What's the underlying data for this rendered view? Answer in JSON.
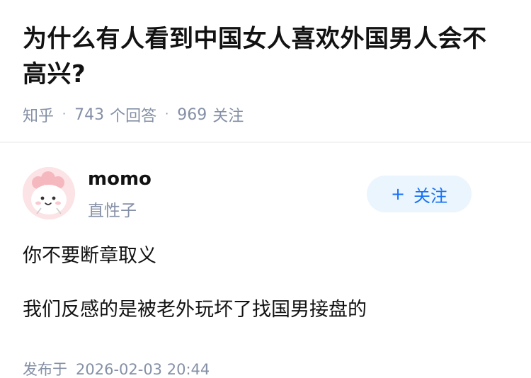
{
  "question": {
    "title": "为什么有人看到中国女人喜欢外国男人会不高兴?",
    "source": "知乎",
    "answer_count": "743",
    "answer_unit": "个回答",
    "follower_count": "969",
    "follower_unit": "关注"
  },
  "answer": {
    "author": {
      "name": "momo",
      "bio": "直性子",
      "avatar_icon": "cartoon-avatar-icon"
    },
    "follow_button": {
      "plus": "+",
      "label": "关注"
    },
    "paragraphs": [
      "你不要断章取义",
      "我们反感的是被老外玩坏了找国男接盘的"
    ],
    "published_label": "发布于",
    "published_time": "2026-02-03 20:44"
  },
  "colors": {
    "primary_text": "#121212",
    "secondary_text": "#8590a6",
    "accent": "#1772f6",
    "follow_bg": "#ebf5fd"
  }
}
